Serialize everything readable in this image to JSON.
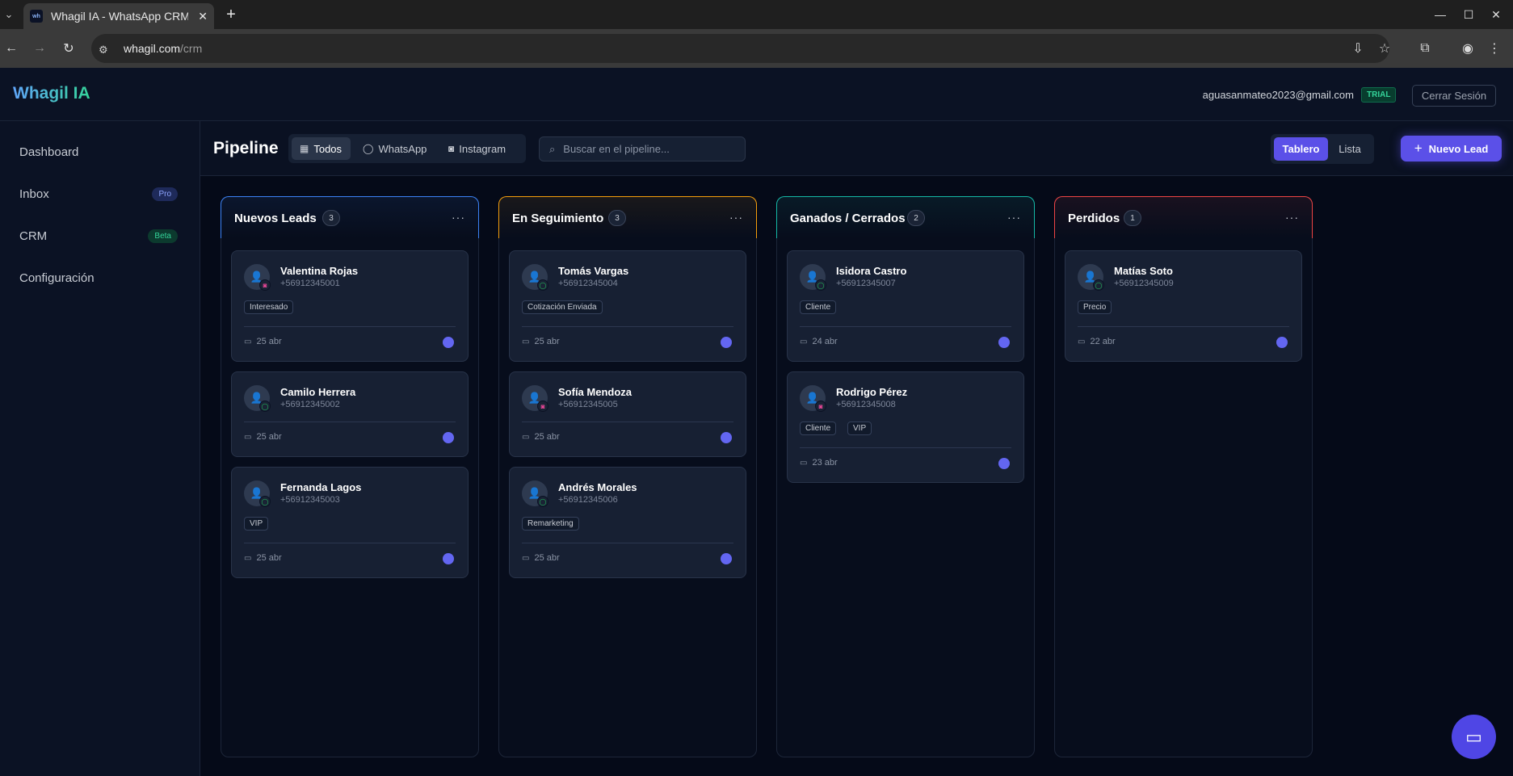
{
  "browser": {
    "tab_title": "Whagil IA - WhatsApp CRM",
    "favicon_text": "wh",
    "url_host": "whagil.com",
    "url_path": "/crm"
  },
  "header": {
    "logo": "Whagil IA",
    "user_email": "aguasanmateo2023@gmail.com",
    "plan_badge": "TRIAL",
    "logout_label": "Cerrar Sesión"
  },
  "sidebar": {
    "items": [
      {
        "label": "Dashboard",
        "badge": ""
      },
      {
        "label": "Inbox",
        "badge": "Pro"
      },
      {
        "label": "CRM",
        "badge": "Beta"
      },
      {
        "label": "Configuración",
        "badge": ""
      }
    ]
  },
  "toolbar": {
    "title": "Pipeline",
    "filters": [
      {
        "label": "Todos",
        "icon": "grid-icon",
        "active": true
      },
      {
        "label": "WhatsApp",
        "icon": "chat-bubble-icon",
        "active": false
      },
      {
        "label": "Instagram",
        "icon": "instagram-icon",
        "active": false
      }
    ],
    "search_placeholder": "Buscar en el pipeline...",
    "view_options": [
      {
        "label": "Tablero",
        "active": true
      },
      {
        "label": "Lista",
        "active": false
      }
    ],
    "new_lead_label": "Nuevo Lead"
  },
  "columns": [
    {
      "title": "Nuevos Leads",
      "count": "3",
      "accent": "#3b82f6",
      "cards": [
        {
          "name": "Valentina Rojas",
          "phone": "+56912345001",
          "channel": "instagram",
          "tags": [
            "Interesado"
          ],
          "date": "25 abr"
        },
        {
          "name": "Camilo Herrera",
          "phone": "+56912345002",
          "channel": "whatsapp",
          "tags": [],
          "date": "25 abr"
        },
        {
          "name": "Fernanda Lagos",
          "phone": "+56912345003",
          "channel": "whatsapp",
          "tags": [
            "VIP"
          ],
          "date": "25 abr"
        }
      ]
    },
    {
      "title": "En Seguimiento",
      "count": "3",
      "accent": "#f59e0b",
      "cards": [
        {
          "name": "Tomás Vargas",
          "phone": "+56912345004",
          "channel": "whatsapp",
          "tags": [
            "Cotización Enviada"
          ],
          "date": "25 abr"
        },
        {
          "name": "Sofía Mendoza",
          "phone": "+56912345005",
          "channel": "instagram",
          "tags": [],
          "date": "25 abr"
        },
        {
          "name": "Andrés Morales",
          "phone": "+56912345006",
          "channel": "whatsapp",
          "tags": [
            "Remarketing"
          ],
          "date": "25 abr"
        }
      ]
    },
    {
      "title": "Ganados / Cerrados",
      "count": "2",
      "accent": "#14b8a6",
      "cards": [
        {
          "name": "Isidora Castro",
          "phone": "+56912345007",
          "channel": "whatsapp",
          "tags": [
            "Cliente"
          ],
          "date": "24 abr"
        },
        {
          "name": "Rodrigo Pérez",
          "phone": "+56912345008",
          "channel": "instagram",
          "tags": [
            "Cliente",
            "VIP"
          ],
          "date": "23 abr"
        }
      ]
    },
    {
      "title": "Perdidos",
      "count": "1",
      "accent": "#ef4444",
      "cards": [
        {
          "name": "Matías Soto",
          "phone": "+56912345009",
          "channel": "whatsapp",
          "tags": [
            "Precio"
          ],
          "date": "22 abr"
        }
      ]
    }
  ],
  "colors": {
    "primary": "#5b50e8",
    "background": "#050a18",
    "whatsapp": "#22c55e",
    "instagram": "#ec4899"
  }
}
